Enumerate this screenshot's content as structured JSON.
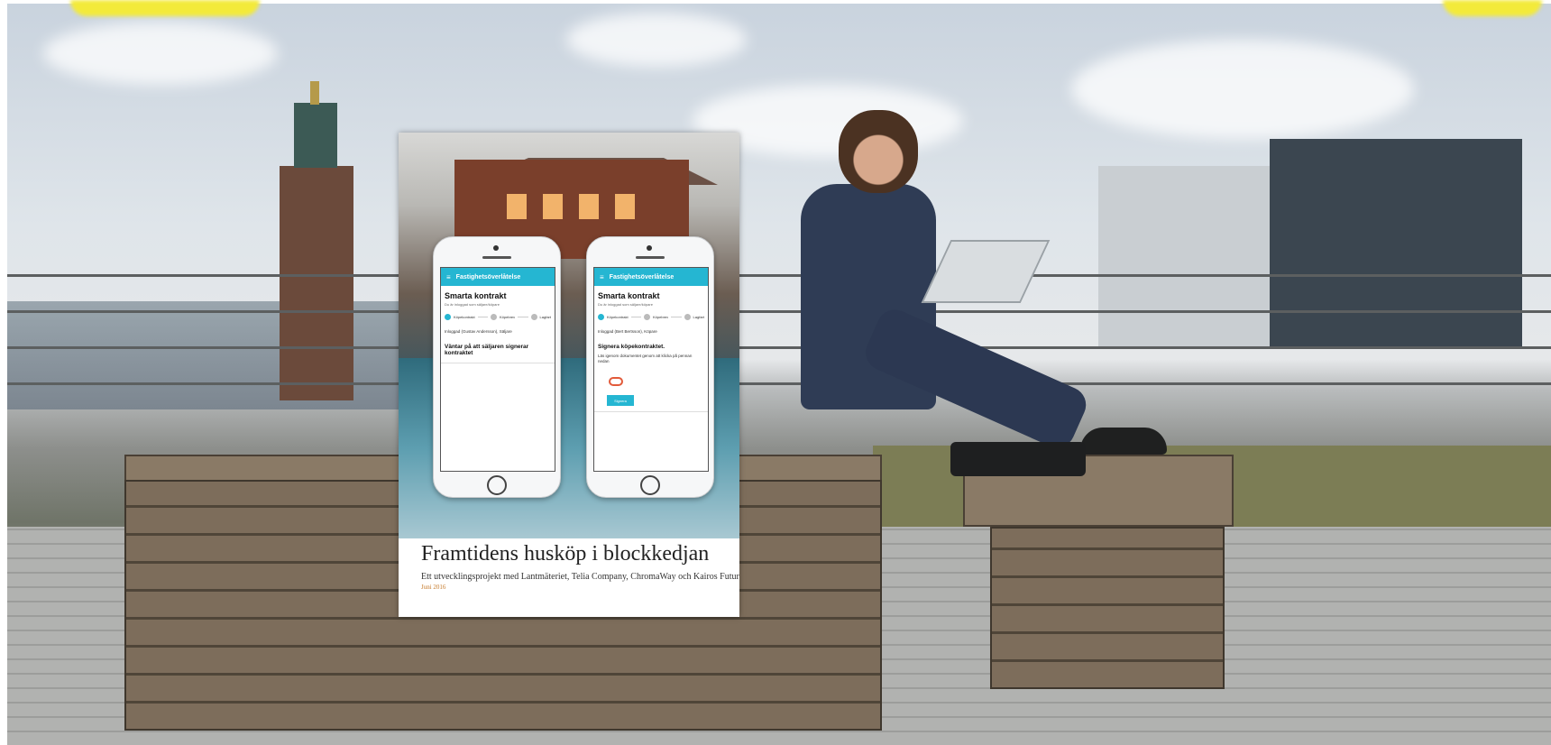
{
  "report": {
    "title": "Framtidens husköp i blockkedjan",
    "subtitle": "Ett utvecklingsprojekt med Lantmäteriet, Telia Company, ChromaWay och Kairos Future",
    "date": "Juni 2016"
  },
  "phones": [
    {
      "app_bar": "Fastighetsöverlåtelse",
      "menu_icon": "hamburger-icon",
      "title": "Smarta kontrakt",
      "subtitle": "Du är inloggad som säljare/köpare",
      "steps": [
        "Köpekontrakt",
        "Köpebrev",
        "Lagfart"
      ],
      "body": "Inloggad (Gustav Andersson), Säljare",
      "heading": "Väntar på att säljaren signerar kontraktet"
    },
    {
      "app_bar": "Fastighetsöverlåtelse",
      "menu_icon": "hamburger-icon",
      "title": "Smarta kontrakt",
      "subtitle": "Du är inloggad som säljare/köpare",
      "steps": [
        "Köpekontrakt",
        "Köpebrev",
        "Lagfart"
      ],
      "body": "Inloggad (Bert Bertsson), Köpare",
      "heading": "Signera köpekontraktet.",
      "note": "Läs igenom dokumentet genom att klicka på pennan nedan",
      "attachment_icon": "paperclip-icon",
      "button": "Signera"
    }
  ],
  "colors": {
    "app_accent": "#25b6d2",
    "date_accent": "#c67a2a",
    "highlight": "#f3ea3a"
  }
}
